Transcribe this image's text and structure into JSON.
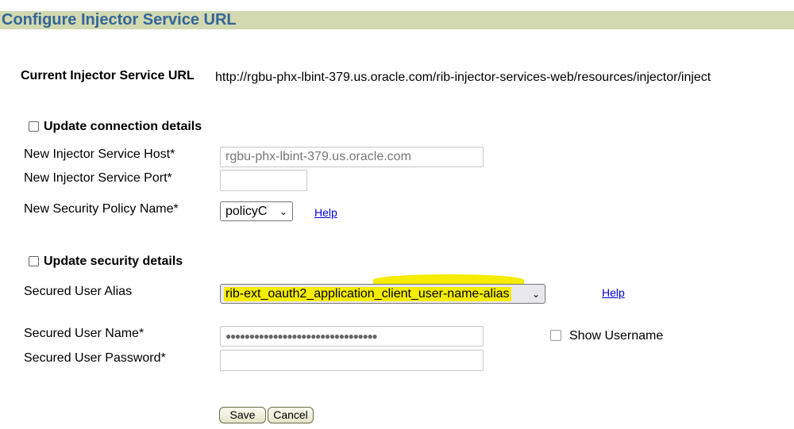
{
  "page": {
    "title": "Configure Injector Service URL"
  },
  "current": {
    "label": "Current Injector Service URL",
    "value": "http://rgbu-phx-lbint-379.us.oracle.com/rib-injector-services-web/resources/injector/inject"
  },
  "connection": {
    "checkbox_label": "Update connection details",
    "checked": false,
    "host_label": "New Injector Service Host*",
    "host_value": "rgbu-phx-lbint-379.us.oracle.com",
    "port_label": "New Injector Service Port*",
    "port_value": "",
    "policy_label": "New Security Policy Name*",
    "policy_value": "policyC",
    "help": "Help"
  },
  "security": {
    "checkbox_label": "Update security details",
    "checked": false,
    "alias_label": "Secured User Alias",
    "alias_value": "rib-ext_oauth2_application_client_user-name-alias",
    "help": "Help",
    "highlight_color": "#f5ec00",
    "username_label": "Secured User Name*",
    "username_value": "●●●●●●●●●●●●●●●●●●●●●●●●●●●●●●●●",
    "show_username_label": "Show Username",
    "show_username_checked": false,
    "password_label": "Secured User Password*",
    "password_value": ""
  },
  "buttons": {
    "save": "Save",
    "cancel": "Cancel"
  }
}
